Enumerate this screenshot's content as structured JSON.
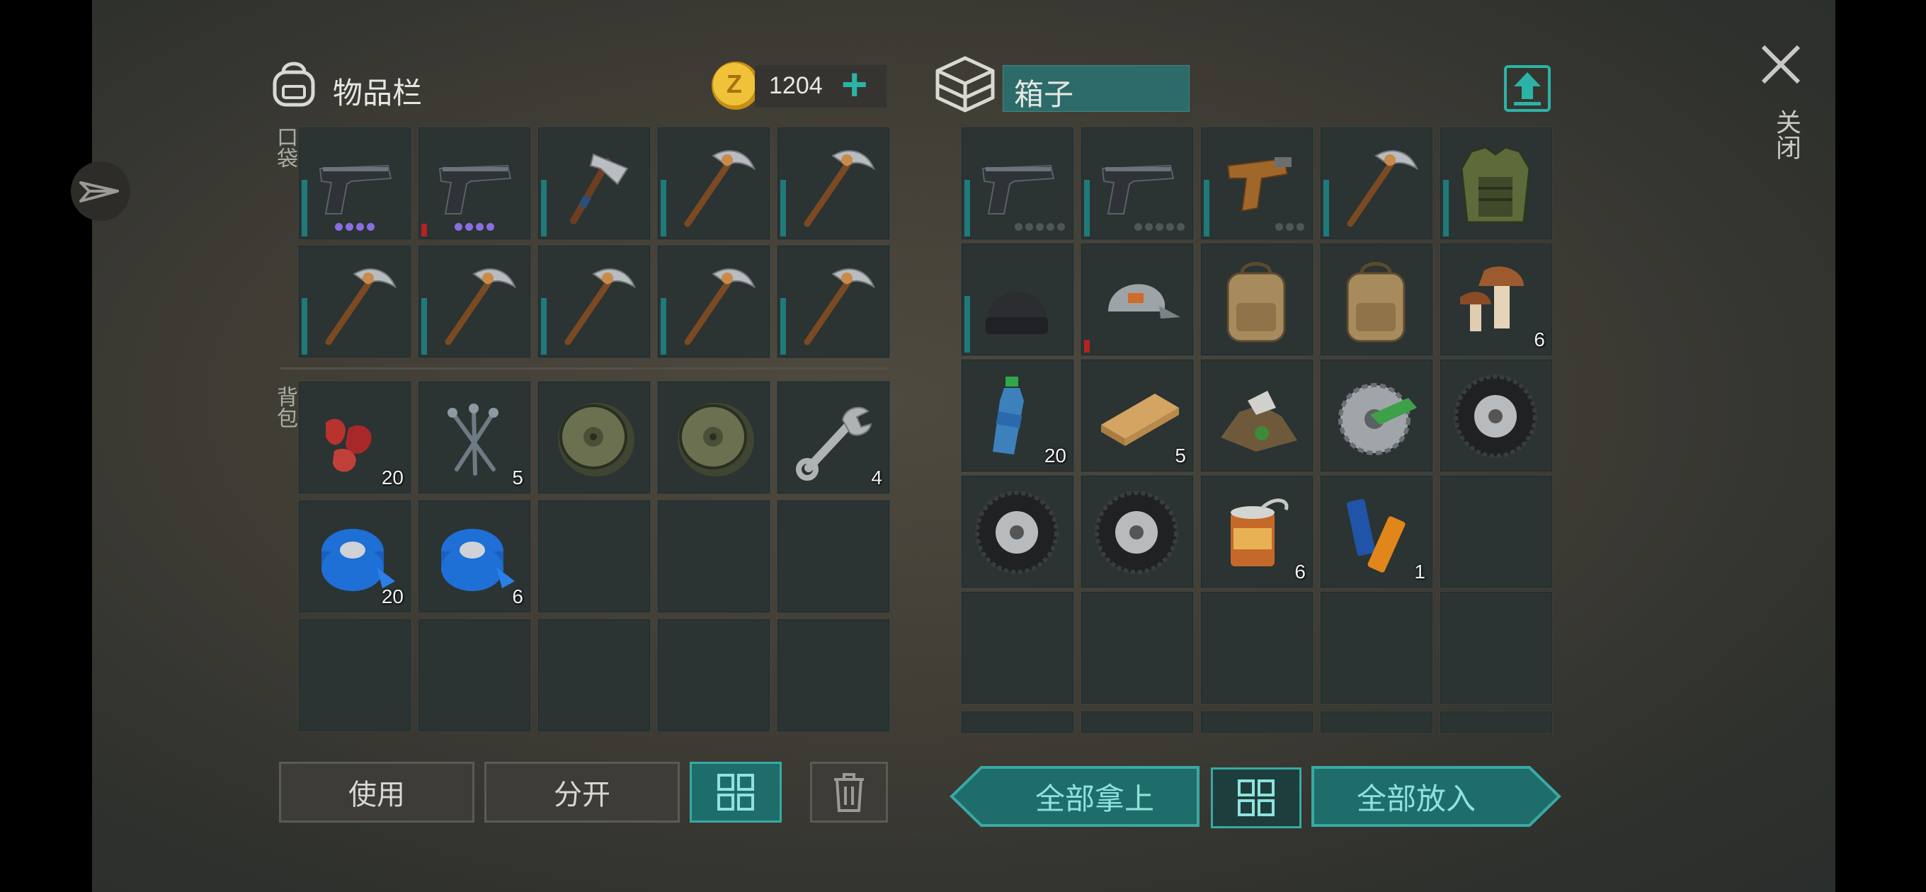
{
  "inventory": {
    "title": "物品栏",
    "pocket_label": "口袋",
    "backpack_label": "背包",
    "coins": "1204",
    "coin_symbol": "Z",
    "add_symbol": "+",
    "pocket_slots": [
      {
        "item": "pistol-icon",
        "dots": 4
      },
      {
        "item": "pistol-icon",
        "dots": 4,
        "red": true
      },
      {
        "item": "hammer-icon"
      },
      {
        "item": "pickaxe-icon"
      },
      {
        "item": "pickaxe-icon"
      },
      {
        "item": "pickaxe-icon"
      },
      {
        "item": "pickaxe-icon"
      },
      {
        "item": "pickaxe-icon"
      },
      {
        "item": "pickaxe-icon"
      },
      {
        "item": "pickaxe-icon"
      }
    ],
    "backpack_slots": [
      {
        "item": "meat-icon",
        "qty": "20"
      },
      {
        "item": "nails-icon",
        "qty": "5"
      },
      {
        "item": "wheel-rim-icon"
      },
      {
        "item": "wheel-rim-icon"
      },
      {
        "item": "wrench-icon",
        "qty": "4"
      },
      {
        "item": "tape-icon",
        "qty": "20"
      },
      {
        "item": "tape-icon",
        "qty": "6"
      },
      {},
      {},
      {},
      {},
      {},
      {},
      {},
      {}
    ]
  },
  "box": {
    "title": "箱子",
    "slots": [
      {
        "item": "pistol-icon",
        "gray_dots": 5
      },
      {
        "item": "pistol-icon",
        "gray_dots": 5
      },
      {
        "item": "flare-gun-icon",
        "gray_dots": 3
      },
      {
        "item": "pickaxe-icon"
      },
      {
        "item": "vest-icon"
      },
      {
        "item": "beanie-icon"
      },
      {
        "item": "cap-icon",
        "red": true
      },
      {
        "item": "backpack-icon"
      },
      {
        "item": "backpack-icon"
      },
      {
        "item": "mushroom-icon",
        "qty": "6"
      },
      {
        "item": "water-bottle-icon",
        "qty": "20"
      },
      {
        "item": "plank-icon",
        "qty": "5"
      },
      {
        "item": "scrap-icon"
      },
      {
        "item": "saw-blade-icon"
      },
      {
        "item": "tire-icon"
      },
      {
        "item": "tire-icon"
      },
      {
        "item": "tire-icon"
      },
      {
        "item": "can-icon",
        "qty": "6"
      },
      {
        "item": "batteries-icon",
        "qty": "1"
      },
      {},
      {},
      {},
      {},
      {},
      {}
    ]
  },
  "buttons": {
    "use": "使用",
    "split": "分开",
    "take_all": "全部拿上",
    "put_all": "全部放入"
  },
  "close_label": "关闭",
  "colors": {
    "teal": "#1f6d6a",
    "teal_light": "#39a9a3",
    "coin": "#e2b12c"
  }
}
